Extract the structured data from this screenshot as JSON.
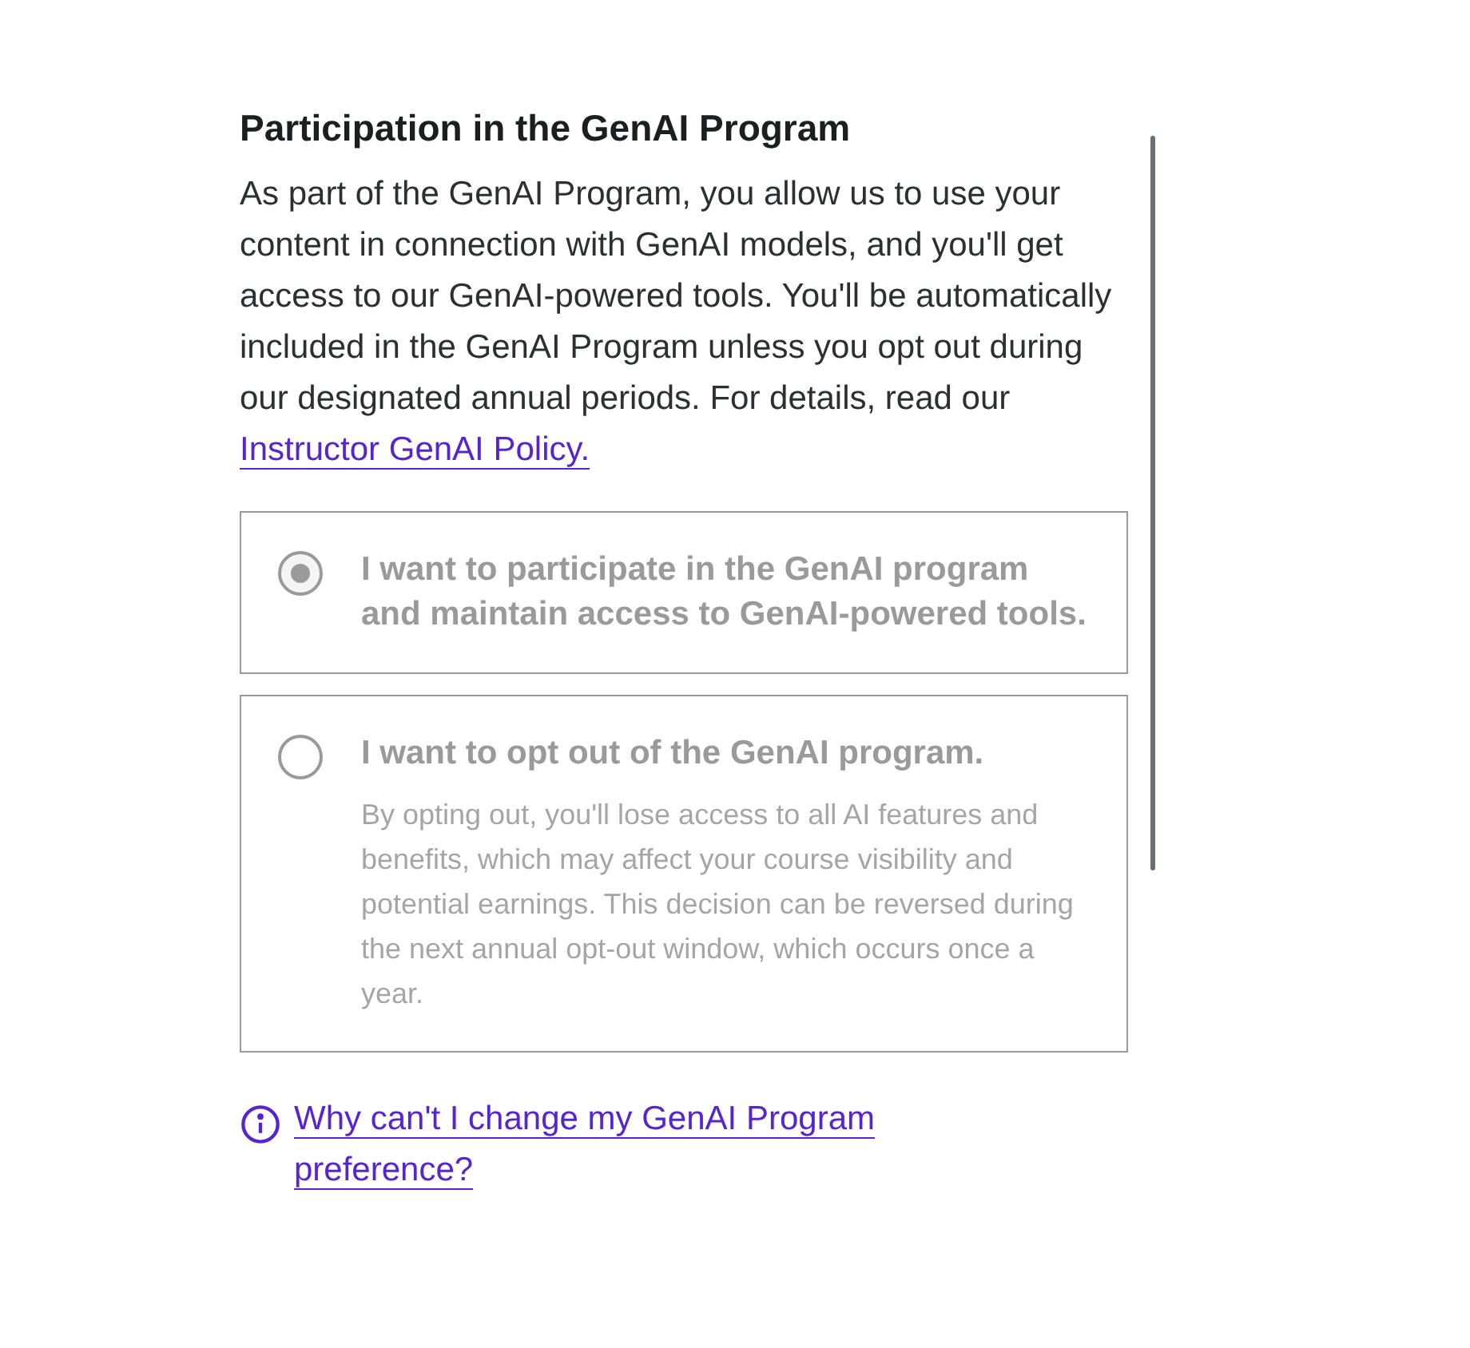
{
  "title": "Participation in the GenAI Program",
  "intro": "As part of the GenAI Program, you allow us to use your content in connection with GenAI models, and you'll get access to our GenAI-powered tools. You'll be automatically included in the GenAI Program unless you opt out during our designated annual periods. For details, read our",
  "intro_link": "Instructor GenAI Policy.",
  "options": [
    {
      "label": "I want to participate in the GenAI program and maintain access to GenAI-powered tools.",
      "selected": true,
      "disabled": true
    },
    {
      "label": "I want to opt out of the GenAI program.",
      "description": "By opting out, you'll lose access to all AI features and benefits, which may affect your course visibility and potential earnings. This decision can be reversed during the next annual opt-out window, which occurs once a year.",
      "selected": false,
      "disabled": true
    }
  ],
  "help_link": "Why can't I change my GenAI Program preference?"
}
